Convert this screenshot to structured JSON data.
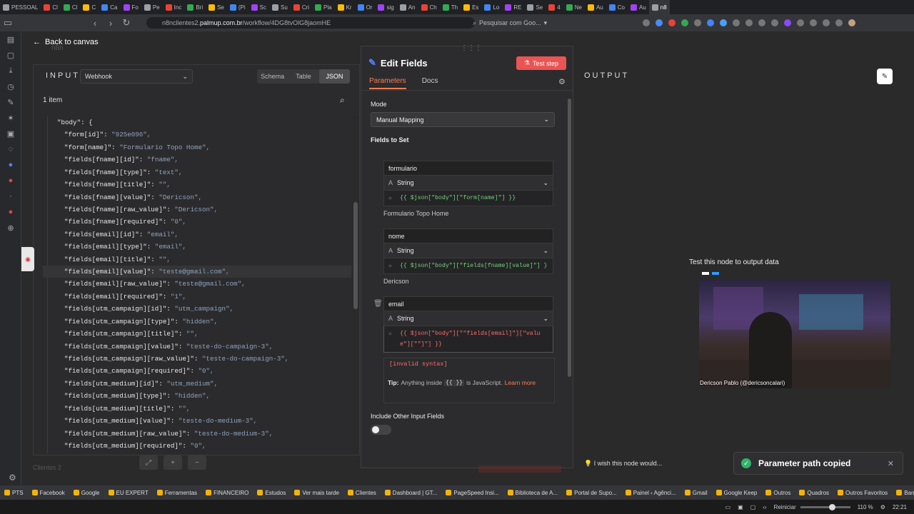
{
  "browser": {
    "tabs": [
      {
        "label": "PESSOAL"
      },
      {
        "label": "Cl"
      },
      {
        "label": "Cl"
      },
      {
        "label": "C"
      },
      {
        "label": "Ca"
      },
      {
        "label": "Fo"
      },
      {
        "label": "Pe"
      },
      {
        "label": "Inc"
      },
      {
        "label": "Bri"
      },
      {
        "label": "Se"
      },
      {
        "label": "(Pi"
      },
      {
        "label": "Sc"
      },
      {
        "label": "Su"
      },
      {
        "label": "Cri"
      },
      {
        "label": "Pla"
      },
      {
        "label": "Kr"
      },
      {
        "label": "Or"
      },
      {
        "label": "sig"
      },
      {
        "label": "An"
      },
      {
        "label": "Ch"
      },
      {
        "label": "Th"
      },
      {
        "label": "Es"
      },
      {
        "label": "Lo"
      },
      {
        "label": "RE"
      },
      {
        "label": "Se"
      },
      {
        "label": "4"
      },
      {
        "label": "Ne"
      },
      {
        "label": "Au"
      },
      {
        "label": "Co"
      },
      {
        "label": "Au"
      },
      {
        "label": "n8"
      }
    ],
    "url_prefix": "n8nclientes2.",
    "url_domain": "palmup.com.br",
    "url_path": "/workflow/4DG8tvOlG8jaomHE",
    "search_engine": "Pesquisar com Goo..."
  },
  "n8n": {
    "back_label": "Back to canvas",
    "back_ghost": "n8n",
    "input": {
      "label": "INPUT",
      "source": "Webhook",
      "view_tabs": [
        "Schema",
        "Table",
        "JSON"
      ],
      "active_view": "JSON",
      "item_count": "1 item",
      "json_lines": [
        {
          "k": "\"body\": {",
          "v": ""
        },
        {
          "k": "\"form[id]\": ",
          "v": "\"925e096\","
        },
        {
          "k": "\"form[name]\": ",
          "v": "\"Formulario Topo Home\","
        },
        {
          "k": "\"fields[fname][id]\": ",
          "v": "\"fname\","
        },
        {
          "k": "\"fields[fname][type]\": ",
          "v": "\"text\","
        },
        {
          "k": "\"fields[fname][title]\": ",
          "v": "\"\","
        },
        {
          "k": "\"fields[fname][value]\": ",
          "v": "\"Dericson\","
        },
        {
          "k": "\"fields[fname][raw_value]\": ",
          "v": "\"Dericson\","
        },
        {
          "k": "\"fields[fname][required]\": ",
          "v": "\"0\","
        },
        {
          "k": "\"fields[email][id]\": ",
          "v": "\"email\","
        },
        {
          "k": "\"fields[email][type]\": ",
          "v": "\"email\","
        },
        {
          "k": "\"fields[email][title]\": ",
          "v": "\"\","
        },
        {
          "k": "\"fields[email][value]\": ",
          "v": "\"teste@gmail.com\","
        },
        {
          "k": "\"fields[email][raw_value]\": ",
          "v": "\"teste@gmail.com\","
        },
        {
          "k": "\"fields[email][required]\": ",
          "v": "\"1\","
        },
        {
          "k": "\"fields[utm_campaign][id]\": ",
          "v": "\"utm_campaign\","
        },
        {
          "k": "\"fields[utm_campaign][type]\": ",
          "v": "\"hidden\","
        },
        {
          "k": "\"fields[utm_campaign][title]\": ",
          "v": "\"\","
        },
        {
          "k": "\"fields[utm_campaign][value]\": ",
          "v": "\"teste-do-campaign-3\","
        },
        {
          "k": "\"fields[utm_campaign][raw_value]\": ",
          "v": "\"teste-do-campaign-3\","
        },
        {
          "k": "\"fields[utm_campaign][required]\": ",
          "v": "\"0\","
        },
        {
          "k": "\"fields[utm_medium][id]\": ",
          "v": "\"utm_medium\","
        },
        {
          "k": "\"fields[utm_medium][type]\": ",
          "v": "\"hidden\","
        },
        {
          "k": "\"fields[utm_medium][title]\": ",
          "v": "\"\","
        },
        {
          "k": "\"fields[utm_medium][value]\": ",
          "v": "\"teste-do-medium-3\","
        },
        {
          "k": "\"fields[utm_medium][raw_value]\": ",
          "v": "\"teste-do-medium-3\","
        },
        {
          "k": "\"fields[utm_medium][required]\": ",
          "v": "\"0\","
        }
      ]
    },
    "edit": {
      "title": "Edit Fields",
      "test_step": "Test step",
      "tab_params": "Parameters",
      "tab_docs": "Docs",
      "mode_label": "Mode",
      "mode_value": "Manual Mapping",
      "fields_label": "Fields to Set",
      "fields": [
        {
          "name": "formulario",
          "type": "String",
          "expr": "{{ $json[\"body\"][\"form[name]\"] }}",
          "result": "Formulario Topo Home"
        },
        {
          "name": "nome",
          "type": "String",
          "expr": "{{ $json[\"body\"][\"fields[fname][value]\"] }",
          "result": "Dericson"
        },
        {
          "name": "email",
          "type": "String",
          "expr": "{{ $json[\"body\"][\"\"fields[email]\"][\"value\"][\"\"]\"] }}",
          "result": ""
        }
      ],
      "invalid": "[invalid syntax]",
      "tip_bold": "Tip:",
      "tip_text": "Anything inside",
      "tip_code": "{{ }}",
      "tip_text2": "is JavaScript.",
      "tip_link": "Learn more",
      "include_label": "Include Other Input Fields"
    },
    "output": {
      "label": "OUTPUT",
      "hint": "Test this node to output data",
      "webcam_caption": "Dericson Pablo (@dericsoncalari)",
      "feedback": "I wish this node would..."
    },
    "toast": "Parameter path copied",
    "bottom_ghost": "Clientes 2"
  },
  "bookmarks": [
    "PTS",
    "Facebook",
    "Google",
    "EU EXPERT",
    "Ferramentas",
    "FINANCEIRO",
    "Estudos",
    "Ver mais tarde",
    "Clientes",
    "Dashboard | GT...",
    "PageSpeed Insi...",
    "Biblioteca de A...",
    "Portal de Supo...",
    "Painel ‹ Agênci...",
    "Gmail",
    "Google Keep",
    "Outros",
    "Quadros",
    "Outros Favoritos",
    "Barra de Marca..."
  ],
  "taskbar": {
    "restart": "Reiniciar",
    "zoom": "110 %",
    "time": "22:21"
  }
}
